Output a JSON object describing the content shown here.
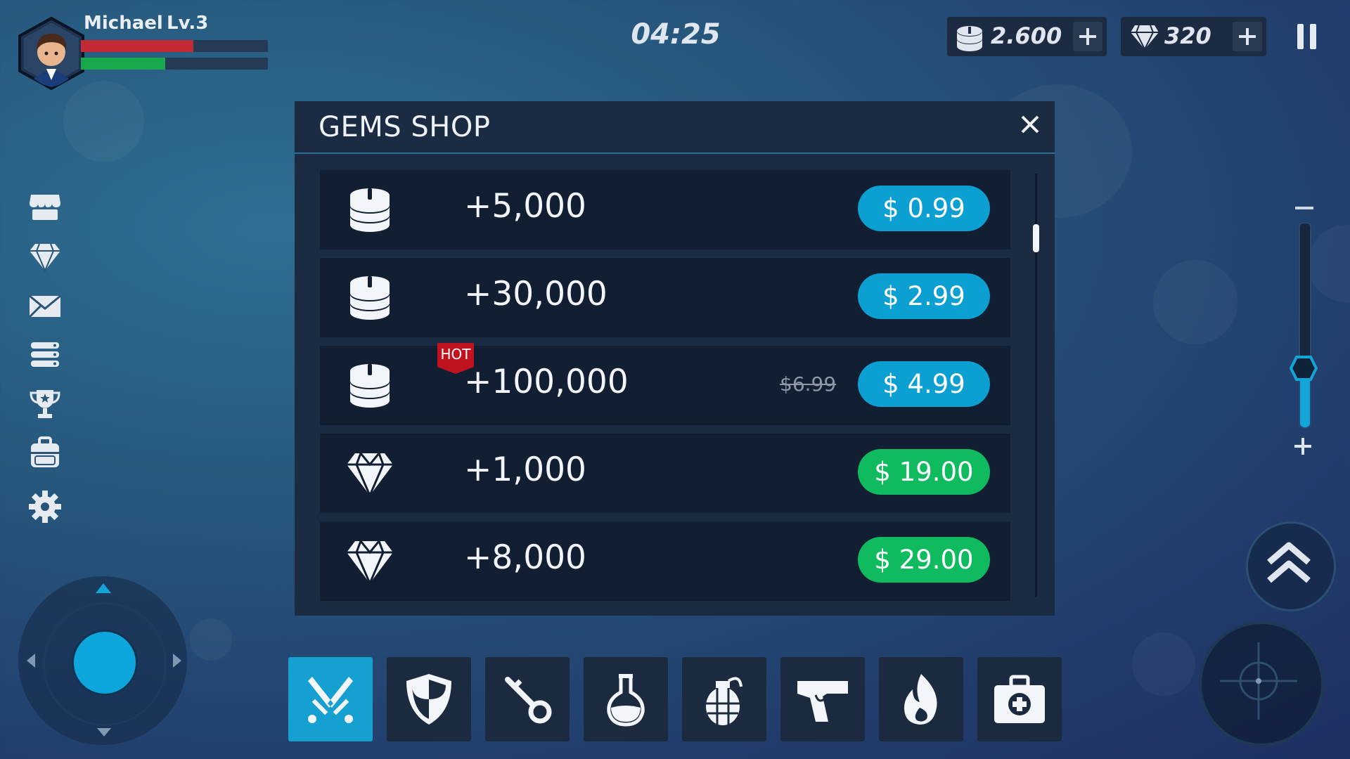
{
  "player": {
    "name": "Michael",
    "level": "Lv.3",
    "health_fraction": 0.6,
    "xp_fraction": 0.45
  },
  "timer": "04:25",
  "currency": {
    "coins": "2.600",
    "gems": "320"
  },
  "sidebar": [
    "shop-icon",
    "gem-icon",
    "mail-icon",
    "list-icon",
    "trophy-icon",
    "backpack-icon",
    "gear-icon"
  ],
  "shop": {
    "title": "GEMS SHOP",
    "items": [
      {
        "kind": "coins",
        "amount": "+5,000",
        "price": "$  0.99",
        "color": "#0c9fd2"
      },
      {
        "kind": "coins",
        "amount": "+30,000",
        "price": "$  2.99",
        "color": "#0c9fd2"
      },
      {
        "kind": "coins",
        "amount": "+100,000",
        "price": "$  4.99",
        "old_price": "$6.99",
        "badge": "HOT",
        "color": "#0c9fd2"
      },
      {
        "kind": "gems",
        "amount": "+1,000",
        "price": "$ 19.00",
        "color": "#0fbb5e"
      },
      {
        "kind": "gems",
        "amount": "+8,000",
        "price": "$ 29.00",
        "color": "#0fbb5e"
      }
    ]
  },
  "zoom_level": 0.3,
  "toolbar": [
    "swords-icon",
    "shield-icon",
    "key-icon",
    "potion-icon",
    "grenade-icon",
    "pistol-icon",
    "fire-icon",
    "medkit-icon"
  ]
}
